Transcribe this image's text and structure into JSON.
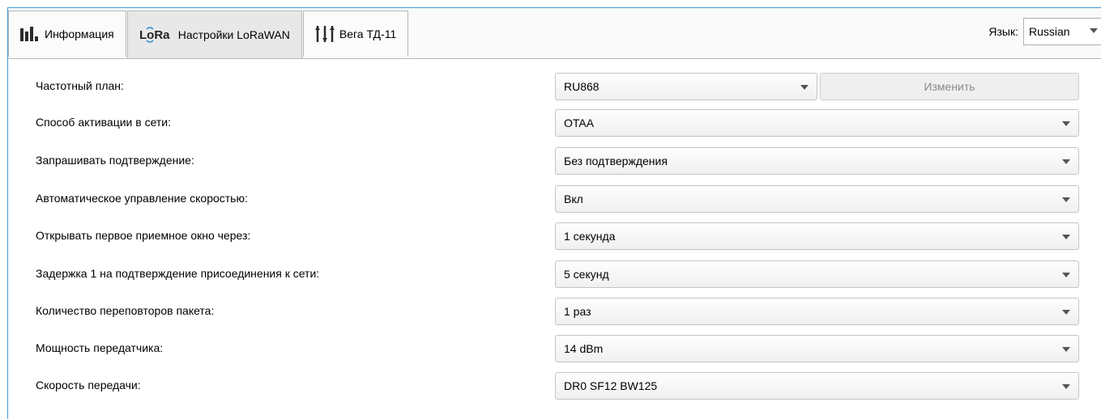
{
  "tabs": [
    {
      "label": "Информация",
      "icon": "bar-chart-icon"
    },
    {
      "label": "Настройки LoRaWAN",
      "icon": "lora-icon",
      "icon_text": "LoRa"
    },
    {
      "label": "Вега ТД-11",
      "icon": "sliders-icon"
    }
  ],
  "language": {
    "label": "Язык:",
    "value": "Russian"
  },
  "settings": {
    "freq_plan": {
      "label": "Частотный план:",
      "value": "RU868",
      "button": "Изменить"
    },
    "activation": {
      "label": "Способ активации в сети:",
      "value": "OTAA"
    },
    "confirm": {
      "label": "Запрашивать подтверждение:",
      "value": "Без подтверждения"
    },
    "adr": {
      "label": "Автоматическое управление скоростью:",
      "value": "Вкл"
    },
    "rx1": {
      "label": "Открывать первое приемное окно через:",
      "value": "1 секунда"
    },
    "join_delay": {
      "label": "Задержка 1 на подтверждение присоединения к сети:",
      "value": "5 секунд"
    },
    "retries": {
      "label": "Количество переповторов пакета:",
      "value": "1 раз"
    },
    "tx_power": {
      "label": "Мощность передатчика:",
      "value": "14 dBm"
    },
    "datarate": {
      "label": "Скорость передачи:",
      "value": "DR0 SF12 BW125"
    }
  },
  "colors": {
    "frame_accent": "#3aa0d8",
    "lora_blue": "#2a8fd0"
  }
}
